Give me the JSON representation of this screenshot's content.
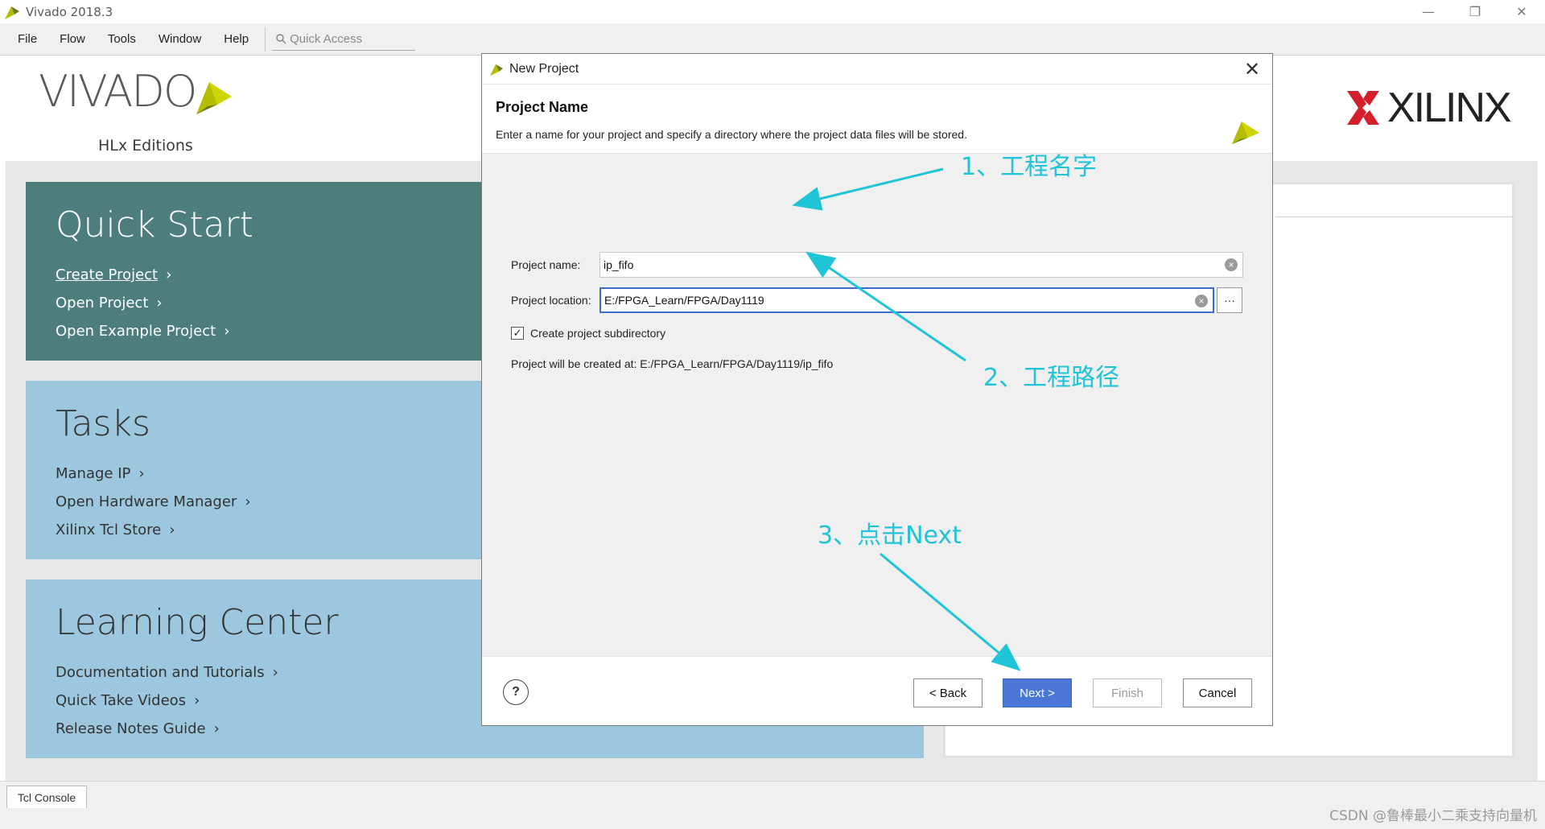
{
  "window": {
    "title": "Vivado 2018.3",
    "controls": {
      "minimize": "—",
      "restore": "❐",
      "close": "✕"
    }
  },
  "menubar": {
    "items": [
      "File",
      "Flow",
      "Tools",
      "Window",
      "Help"
    ],
    "quick_access_placeholder": "Quick Access"
  },
  "branding": {
    "vivado_word": "VIVADO",
    "vivado_sub": "HLx Editions",
    "xilinx_word": "XILINX"
  },
  "quick_start": {
    "title": "Quick Start",
    "links": [
      "Create Project",
      "Open Project",
      "Open Example Project"
    ]
  },
  "tasks": {
    "title": "Tasks",
    "links": [
      "Manage IP",
      "Open Hardware Manager",
      "Xilinx Tcl Store"
    ]
  },
  "learning_center": {
    "title": "Learning Center",
    "links": [
      "Documentation and Tutorials",
      "Quick Take Videos",
      "Release Notes Guide"
    ]
  },
  "bottom": {
    "tcl_tab": "Tcl Console",
    "watermark": "CSDN @鲁棒最小二乘支持向量机"
  },
  "dialog": {
    "title": "New Project",
    "heading": "Project Name",
    "description": "Enter a name for your project and specify a directory where the project data files will be stored.",
    "project_name_label": "Project name:",
    "project_name_value": "ip_fifo",
    "project_location_label": "Project location:",
    "project_location_value": "E:/FPGA_Learn/FPGA/Day1119",
    "browse_label": "···",
    "subdir_checkbox_label": "Create project subdirectory",
    "subdir_checked": true,
    "created_at_text": "Project will be created at: E:/FPGA_Learn/FPGA/Day1119/ip_fifo",
    "buttons": {
      "help": "?",
      "back": "< Back",
      "next": "Next >",
      "finish": "Finish",
      "cancel": "Cancel"
    }
  },
  "annotations": {
    "step1": "1、工程名字",
    "step2": "2、工程路径",
    "step3": "3、点击Next",
    "color": "#1fc4d6"
  },
  "colors": {
    "quick_start_bg": "#4d7e7b",
    "tasks_bg": "#9cc7df",
    "primary_button": "#4a76d8",
    "vivado_green": "#b5bd00"
  }
}
